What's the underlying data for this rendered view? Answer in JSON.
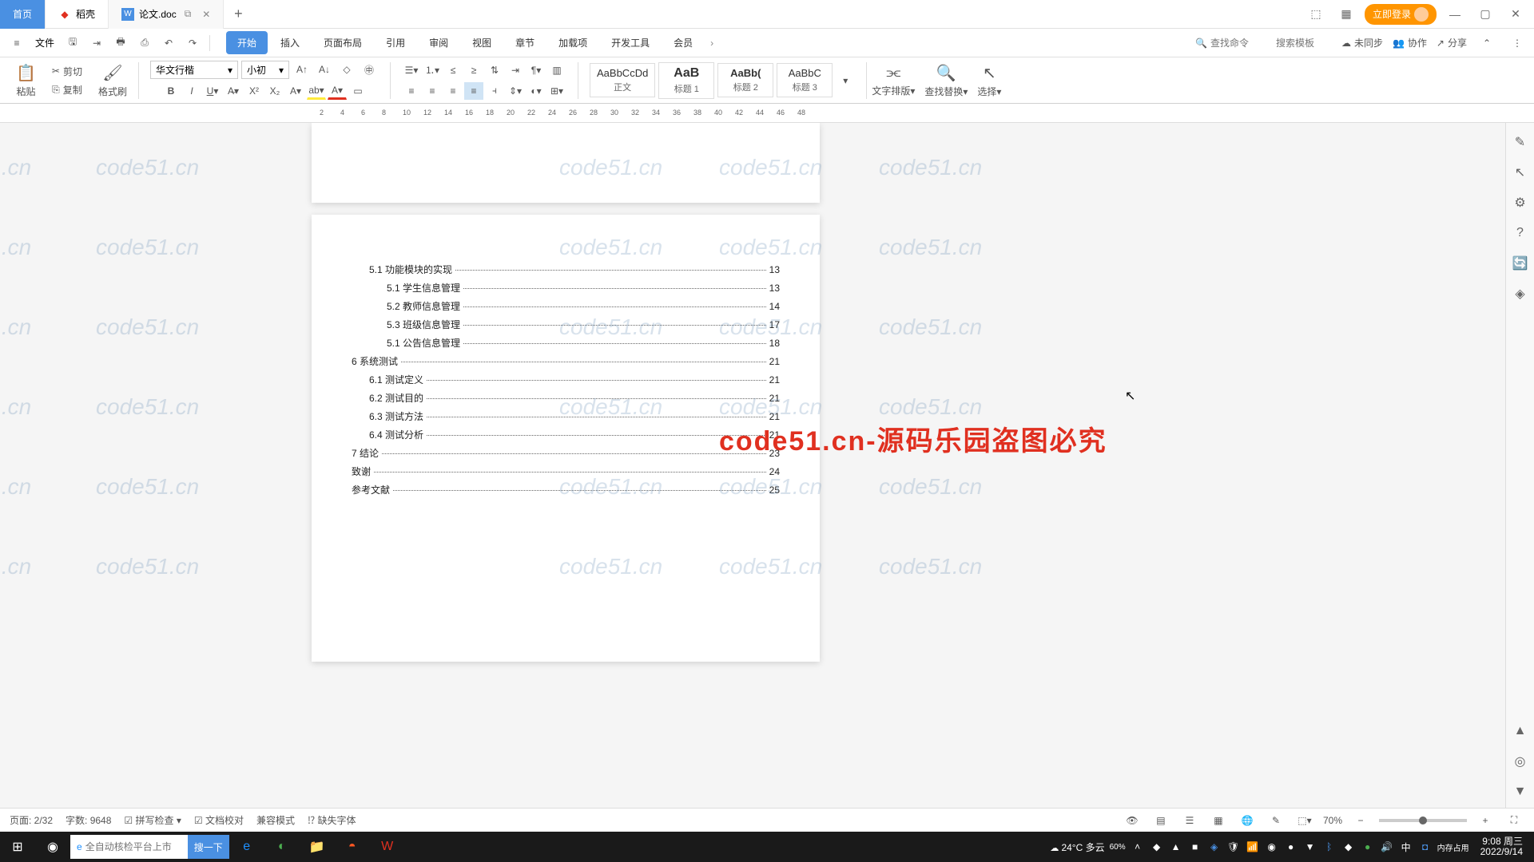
{
  "tabs": {
    "home": "首页",
    "docai": "稻壳",
    "doc": "论文.doc"
  },
  "titlebar": {
    "login": "立即登录"
  },
  "toolbar": {
    "file": "文件"
  },
  "ribbonTabs": {
    "start": "开始",
    "insert": "插入",
    "layout": "页面布局",
    "ref": "引用",
    "review": "审阅",
    "view": "视图",
    "chapter": "章节",
    "addon": "加载项",
    "dev": "开发工具",
    "member": "会员"
  },
  "search": {
    "cmd": "查找命令",
    "tpl": "搜索模板"
  },
  "tbr": {
    "sync": "未同步",
    "collab": "协作",
    "share": "分享"
  },
  "clipboard": {
    "paste": "粘贴",
    "cut": "剪切",
    "copy": "复制",
    "brush": "格式刷"
  },
  "font": {
    "name": "华文行楷",
    "size": "小初"
  },
  "styles": {
    "body": {
      "p": "AaBbCcDd",
      "n": "正文"
    },
    "h1": {
      "p": "AaB",
      "n": "标题 1"
    },
    "h2": {
      "p": "AaBb(",
      "n": "标题 2"
    },
    "h3": {
      "p": "AaBbC",
      "n": "标题 3"
    }
  },
  "rActions": {
    "layout": "文字排版",
    "find": "查找替换",
    "select": "选择"
  },
  "ruler": [
    "2",
    "4",
    "6",
    "8",
    "10",
    "12",
    "14",
    "16",
    "18",
    "20",
    "22",
    "24",
    "26",
    "28",
    "30",
    "32",
    "34",
    "36",
    "38",
    "40",
    "42",
    "44",
    "46",
    "48"
  ],
  "toc": [
    {
      "lvl": 2,
      "t": "5.1 功能模块的实现",
      "p": "13"
    },
    {
      "lvl": 3,
      "t": "5.1 学生信息管理",
      "p": "13"
    },
    {
      "lvl": 3,
      "t": "5.2 教师信息管理",
      "p": "14"
    },
    {
      "lvl": 3,
      "t": "5.3 班级信息管理",
      "p": "17"
    },
    {
      "lvl": 3,
      "t": "5.1 公告信息管理",
      "p": "18"
    },
    {
      "lvl": 1,
      "t": "6  系统测试",
      "p": "21"
    },
    {
      "lvl": 2,
      "t": "6.1 测试定义",
      "p": "21"
    },
    {
      "lvl": 2,
      "t": "6.2 测试目的",
      "p": "21"
    },
    {
      "lvl": 2,
      "t": "6.3 测试方法",
      "p": "21"
    },
    {
      "lvl": 2,
      "t": "6.4 测试分析",
      "p": "21"
    },
    {
      "lvl": 1,
      "t": "7  结论",
      "p": "23"
    },
    {
      "lvl": 1,
      "t": "致谢",
      "p": "24"
    },
    {
      "lvl": 1,
      "t": "参考文献",
      "p": "25"
    }
  ],
  "bigwm": "code51.cn-源码乐园盗图必究",
  "wm": "code51.cn",
  "status": {
    "page": "页面: 2/32",
    "words": "字数: 9648",
    "spell": "拼写检查",
    "proof": "文档校对",
    "compat": "兼容模式",
    "missfont": "缺失字体",
    "zoom": "70%"
  },
  "taskbar": {
    "search_placeholder": "全自动核检平台上市",
    "search_btn": "搜一下",
    "weather": "24°C 多云",
    "mem": "内存占用",
    "ime": "中",
    "time": "9:08 周三",
    "date": "2022/9/14",
    "battery": "60%"
  }
}
